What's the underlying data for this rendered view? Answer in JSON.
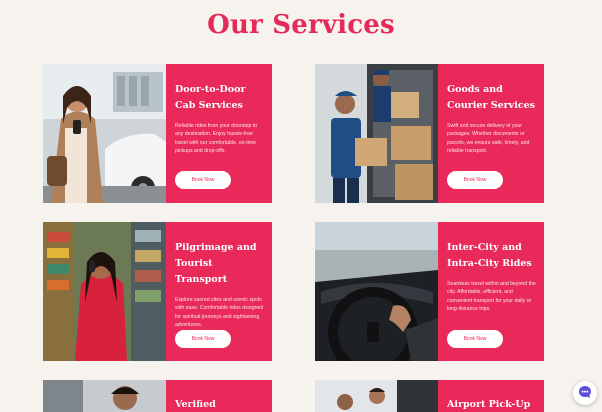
{
  "page": {
    "title": "Our Services"
  },
  "colors": {
    "accent": "#e8295a",
    "title": "#e52a57",
    "background": "#f6f3ee"
  },
  "services": [
    {
      "title": "Door-to-Door Cab Services",
      "description": "Reliable rides from your doorstep to any destination. Enjoy hassle-free travel with our comfortable, on-time pickups and drop-offs.",
      "button_label": "Book Now",
      "image": "woman-with-phone-near-car"
    },
    {
      "title": "Goods and Courier Services",
      "description": "Swift and secure delivery of your packages. Whether documents or parcels, we ensure safe, timely, and reliable transport.",
      "button_label": "Book Now",
      "image": "courier-loading-boxes"
    },
    {
      "title": "Pilgrimage and Tourist Transport",
      "description": "Explore sacred sites and scenic spots with ease. Comfortable rides designed for spiritual journeys and sightseeing adventures.",
      "button_label": "Book Now",
      "image": "woman-on-phone-market"
    },
    {
      "title": "Inter-City and Intra-City Rides",
      "description": "Seamless travel within and beyond the city. Affordable, efficient, and convenient transport for your daily or long-distance trips.",
      "button_label": "Book Now",
      "image": "driver-hands-on-steering-wheel"
    },
    {
      "title": "Verified Professional",
      "image": "professional-driver"
    },
    {
      "title": "Airport Pick-Up and",
      "image": "airport-travellers"
    }
  ],
  "chat": {
    "icon": "chat-assistant-icon"
  }
}
